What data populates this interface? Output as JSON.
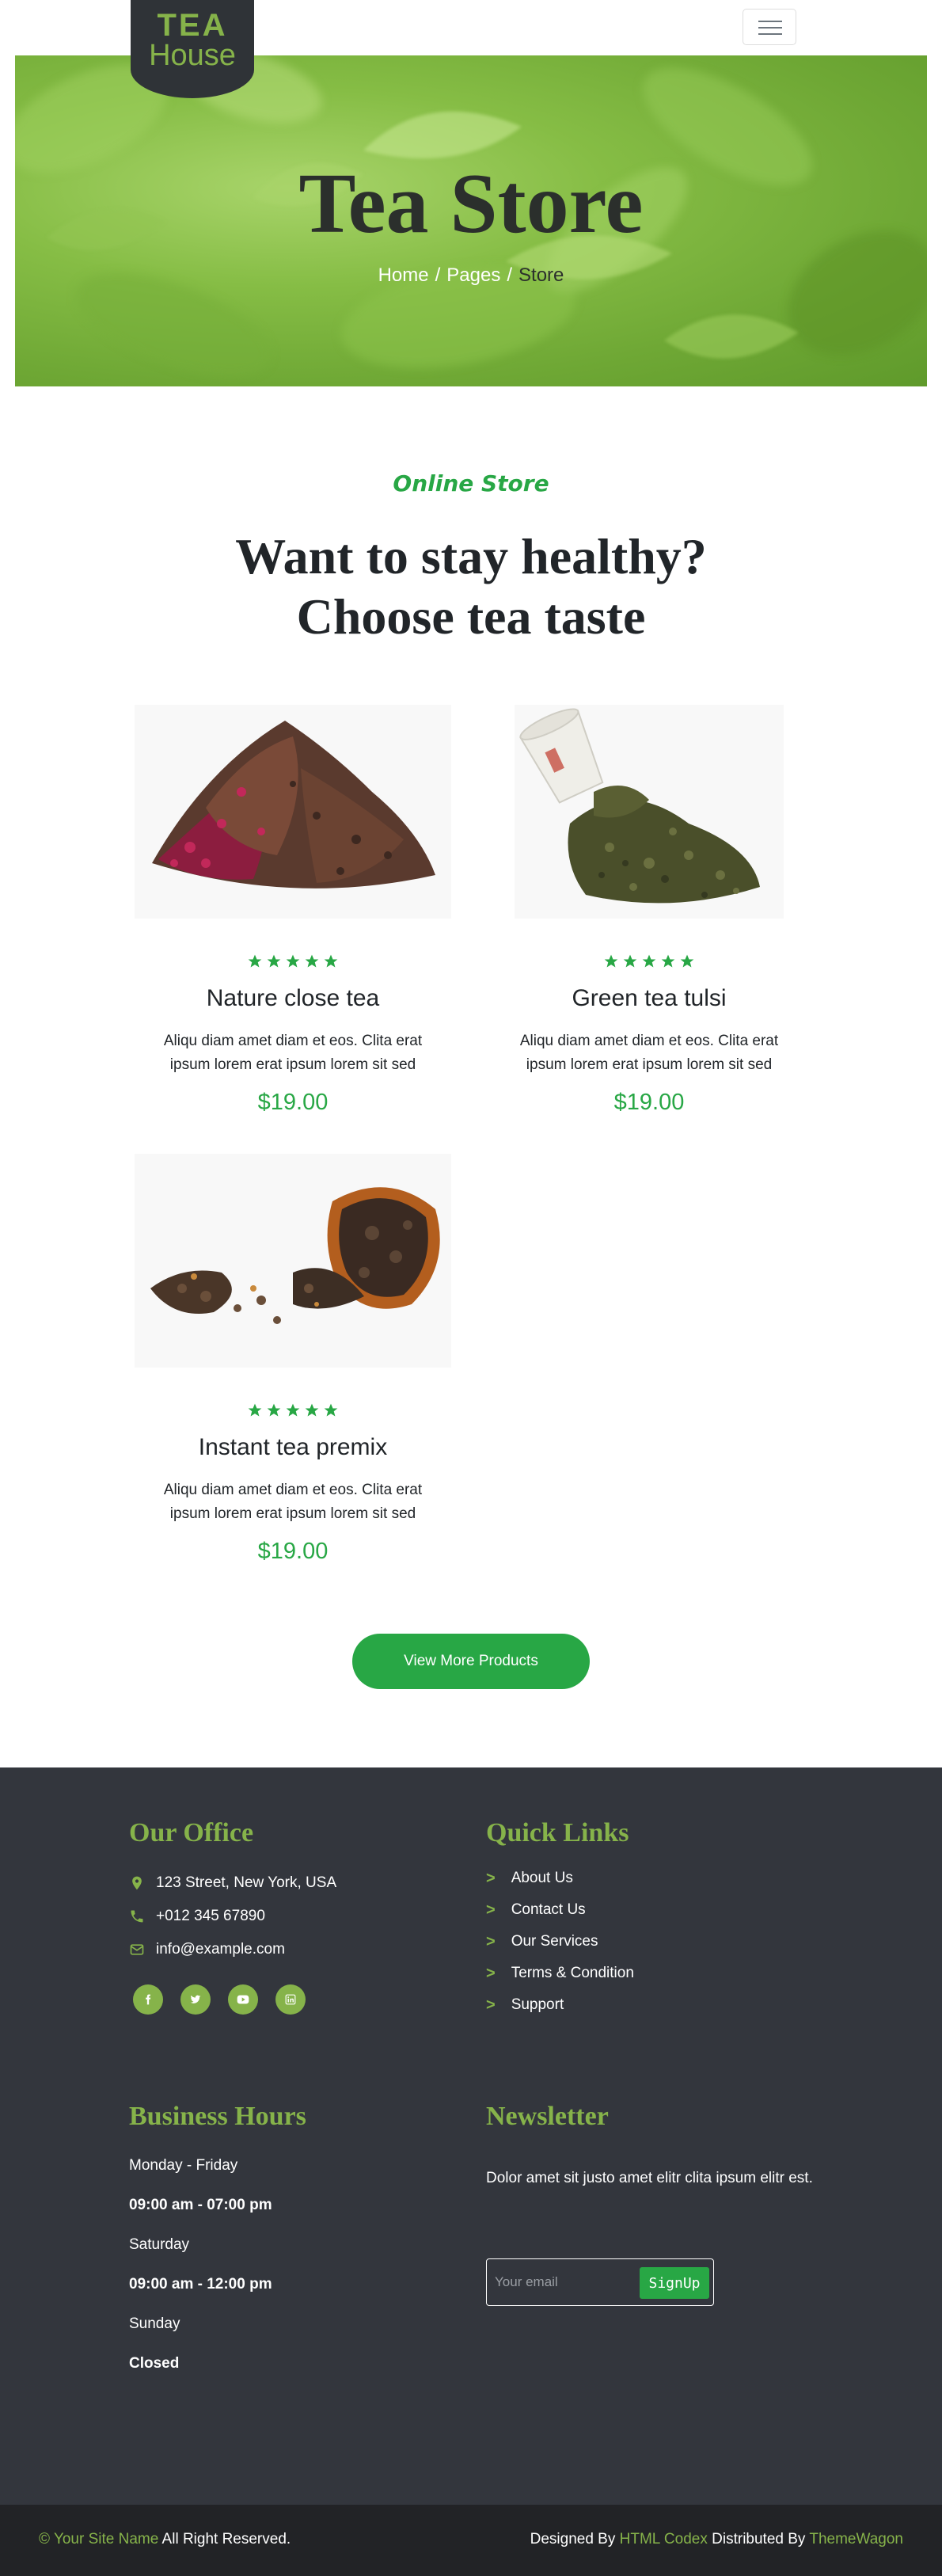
{
  "colors": {
    "primary": "#28a745",
    "brand_green": "#86b34a",
    "footer_bg": "#33363d",
    "dark": "#212529"
  },
  "navbar": {
    "logo_line1": "TEA",
    "logo_line2": "House",
    "toggler_icon": "hamburger-icon"
  },
  "hero": {
    "title": "Tea Store",
    "breadcrumb": {
      "home": "Home",
      "sep1": "/",
      "pages": "Pages",
      "sep2": "/",
      "current": "Store"
    }
  },
  "section": {
    "subtitle": "Online Store",
    "title_line1": "Want to stay healthy?",
    "title_line2": "Choose tea taste"
  },
  "products": [
    {
      "name": "Nature close tea",
      "description": "Aliqu diam amet diam et eos. Clita erat ipsum lorem erat ipsum lorem sit sed",
      "price": "$19.00",
      "rating": 5
    },
    {
      "name": "Green tea tulsi",
      "description": "Aliqu diam amet diam et eos. Clita erat ipsum lorem erat ipsum lorem sit sed",
      "price": "$19.00",
      "rating": 5
    },
    {
      "name": "Instant tea premix",
      "description": "Aliqu diam amet diam et eos. Clita erat ipsum lorem erat ipsum lorem sit sed",
      "price": "$19.00",
      "rating": 5
    }
  ],
  "view_more_label": "View More Products",
  "footer": {
    "office": {
      "title": "Our Office",
      "address": "123 Street, New York, USA",
      "phone": "+012 345 67890",
      "email": "info@example.com",
      "socials": [
        "facebook-icon",
        "twitter-icon",
        "youtube-icon",
        "linkedin-icon"
      ]
    },
    "quick_links": {
      "title": "Quick Links",
      "items": [
        "About Us",
        "Contact Us",
        "Our Services",
        "Terms & Condition",
        "Support"
      ]
    },
    "hours": {
      "title": "Business Hours",
      "lines": [
        "Monday - Friday",
        "09:00 am - 07:00 pm",
        "Saturday",
        "09:00 am - 12:00 pm",
        "Sunday",
        "Closed"
      ]
    },
    "newsletter": {
      "title": "Newsletter",
      "description": "Dolor amet sit justo amet elitr clita ipsum elitr est.",
      "placeholder": "Your email",
      "button": "SignUp"
    }
  },
  "copyright": {
    "symbol": "©",
    "site_name": "Your Site Name",
    "rights": "All Right Reserved.",
    "designed_by": "Designed By",
    "designer": "HTML Codex",
    "distributed_by": "Distributed By",
    "distributor": "ThemeWagon"
  }
}
